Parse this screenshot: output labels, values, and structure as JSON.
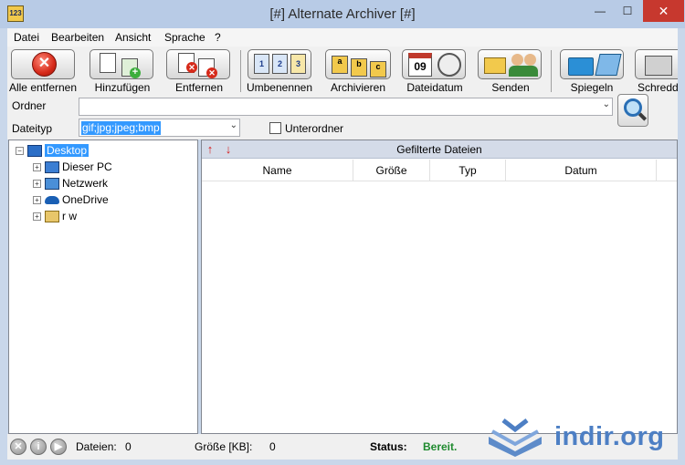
{
  "window": {
    "title": "[#] Alternate Archiver [#]",
    "icon_label": "123",
    "controls": {
      "minimize": "—",
      "maximize": "☐",
      "close": "✕"
    }
  },
  "menu": [
    "Datei",
    "Bearbeiten",
    "Ansicht",
    "Sprache",
    "?"
  ],
  "toolbar": {
    "buttons": [
      {
        "label": "Alle entfernen",
        "icon": "remove-all-icon"
      },
      {
        "label": "Hinzufügen",
        "icon": "add-files-icon"
      },
      {
        "label": "Entfernen",
        "icon": "remove-file-icon"
      },
      {
        "label": "Umbenennen",
        "icon": "rename-icon"
      },
      {
        "label": "Archivieren",
        "icon": "archive-icon"
      },
      {
        "label": "Dateidatum",
        "icon": "file-date-icon"
      },
      {
        "label": "Senden",
        "icon": "send-icon"
      },
      {
        "label": "Spiegeln",
        "icon": "mirror-icon"
      },
      {
        "label": "Schreddern",
        "icon": "shredder-icon"
      }
    ],
    "calendar_number": "09"
  },
  "form": {
    "folder_label": "Ordner",
    "folder_value": "",
    "filetype_label": "Dateityp",
    "filetype_value": "gif;jpg;jpeg;bmp",
    "subfolder_label": "Unterordner",
    "subfolder_checked": false
  },
  "tree": {
    "root": "Desktop",
    "children": [
      "Dieser PC",
      "Netzwerk",
      "OneDrive",
      "r w"
    ]
  },
  "files": {
    "title": "Gefilterte Dateien",
    "columns": [
      "Name",
      "Größe",
      "Typ",
      "Datum"
    ],
    "rows": []
  },
  "status": {
    "files_label": "Dateien:",
    "files_value": "0",
    "size_label": "Größe [KB]:",
    "size_value": "0",
    "status_label": "Status:",
    "status_value": "Bereit."
  },
  "watermark": {
    "text": "indir.org",
    "color": "#4d7fc4"
  },
  "colors": {
    "selection": "#3399ff",
    "close_button": "#c7382e",
    "ready": "#1e8a2e"
  }
}
